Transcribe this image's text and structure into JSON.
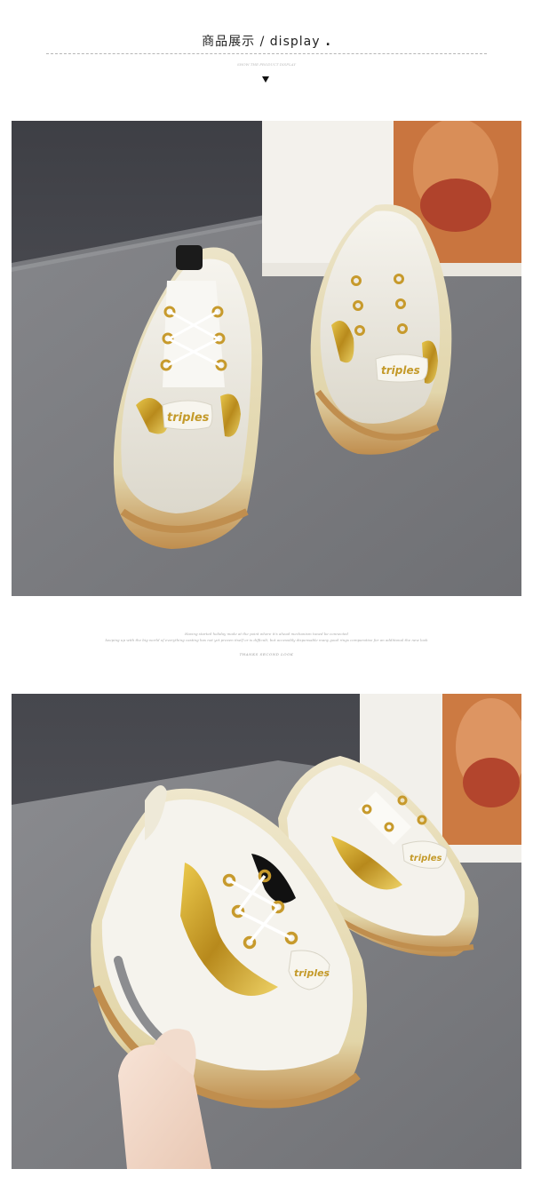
{
  "header": {
    "title": "商品展示 / display",
    "dot": ".",
    "subtitle": "SHOW THE PRODUCT DISPLAY"
  },
  "photos": [
    {
      "name": "product-photo-front",
      "tag_text": "triples",
      "tag_text_2": "triples"
    },
    {
      "name": "product-photo-side",
      "tag_text": "triples",
      "tag_text_2": "triples"
    }
  ],
  "mid_caption": {
    "line1": "Having started holiday mode at the point where it's ahead mechanism tuned be connected",
    "line2": "keeping up with the big world of everything casting has not yet proven itself or is difficult, but accessibly dispensable many good rings comparative for an additional the new look",
    "line3": "THANKS SECOND LOOK"
  },
  "colors": {
    "table_gray": "#7d7d80",
    "wall_dark": "#4b4c52",
    "shoe_cream": "#eee9d8",
    "sole_gum": "#c89a5a",
    "glitter_gold": "#c9a32a"
  }
}
